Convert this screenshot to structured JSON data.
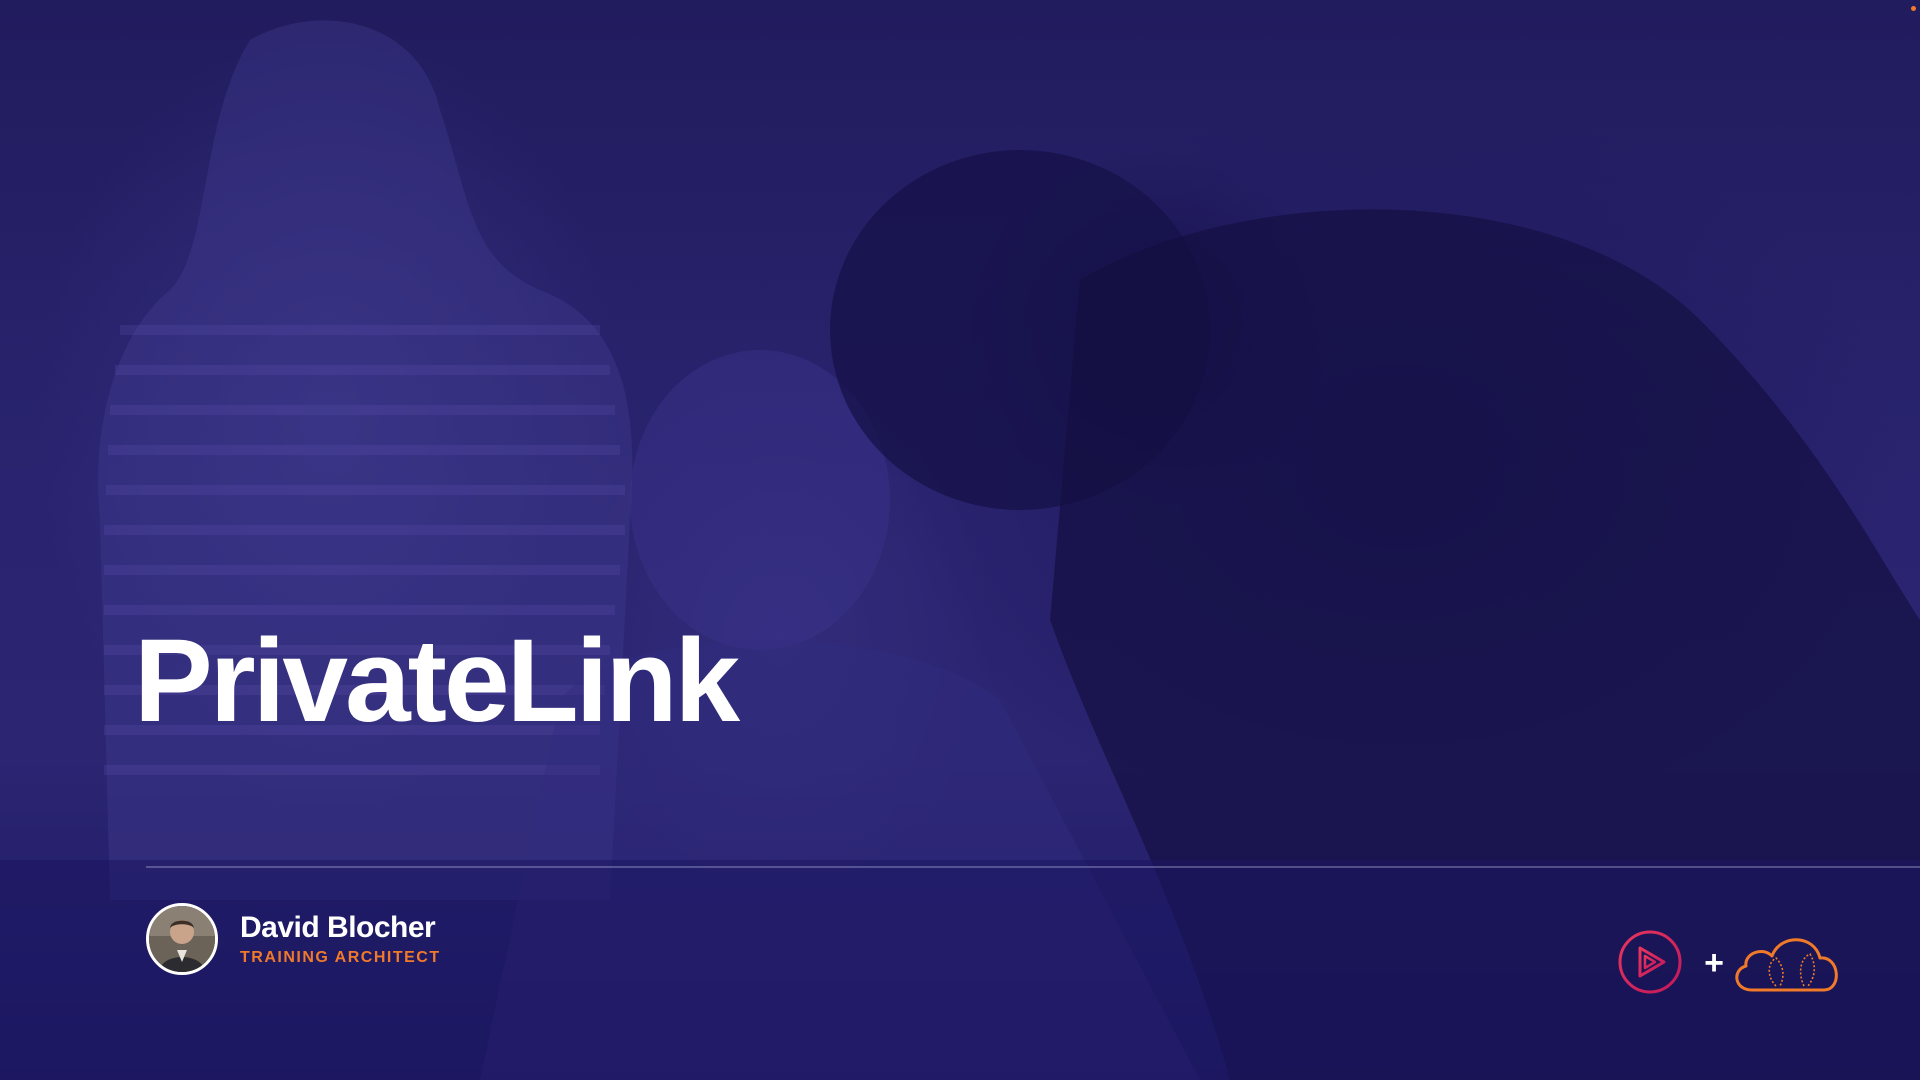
{
  "slide": {
    "title": "PrivateLink"
  },
  "presenter": {
    "name": "David Blocher",
    "role": "TRAINING ARCHITECT"
  },
  "logos": {
    "plus_symbol": "+",
    "left_icon": "play-icon",
    "right_icon": "cloud-icon"
  },
  "colors": {
    "background": "#241e66",
    "title": "#ffffff",
    "role_accent": "#f07a2a",
    "play_gradient_start": "#e8365d",
    "play_gradient_end": "#c2185b",
    "cloud_accent": "#f07a2a"
  }
}
